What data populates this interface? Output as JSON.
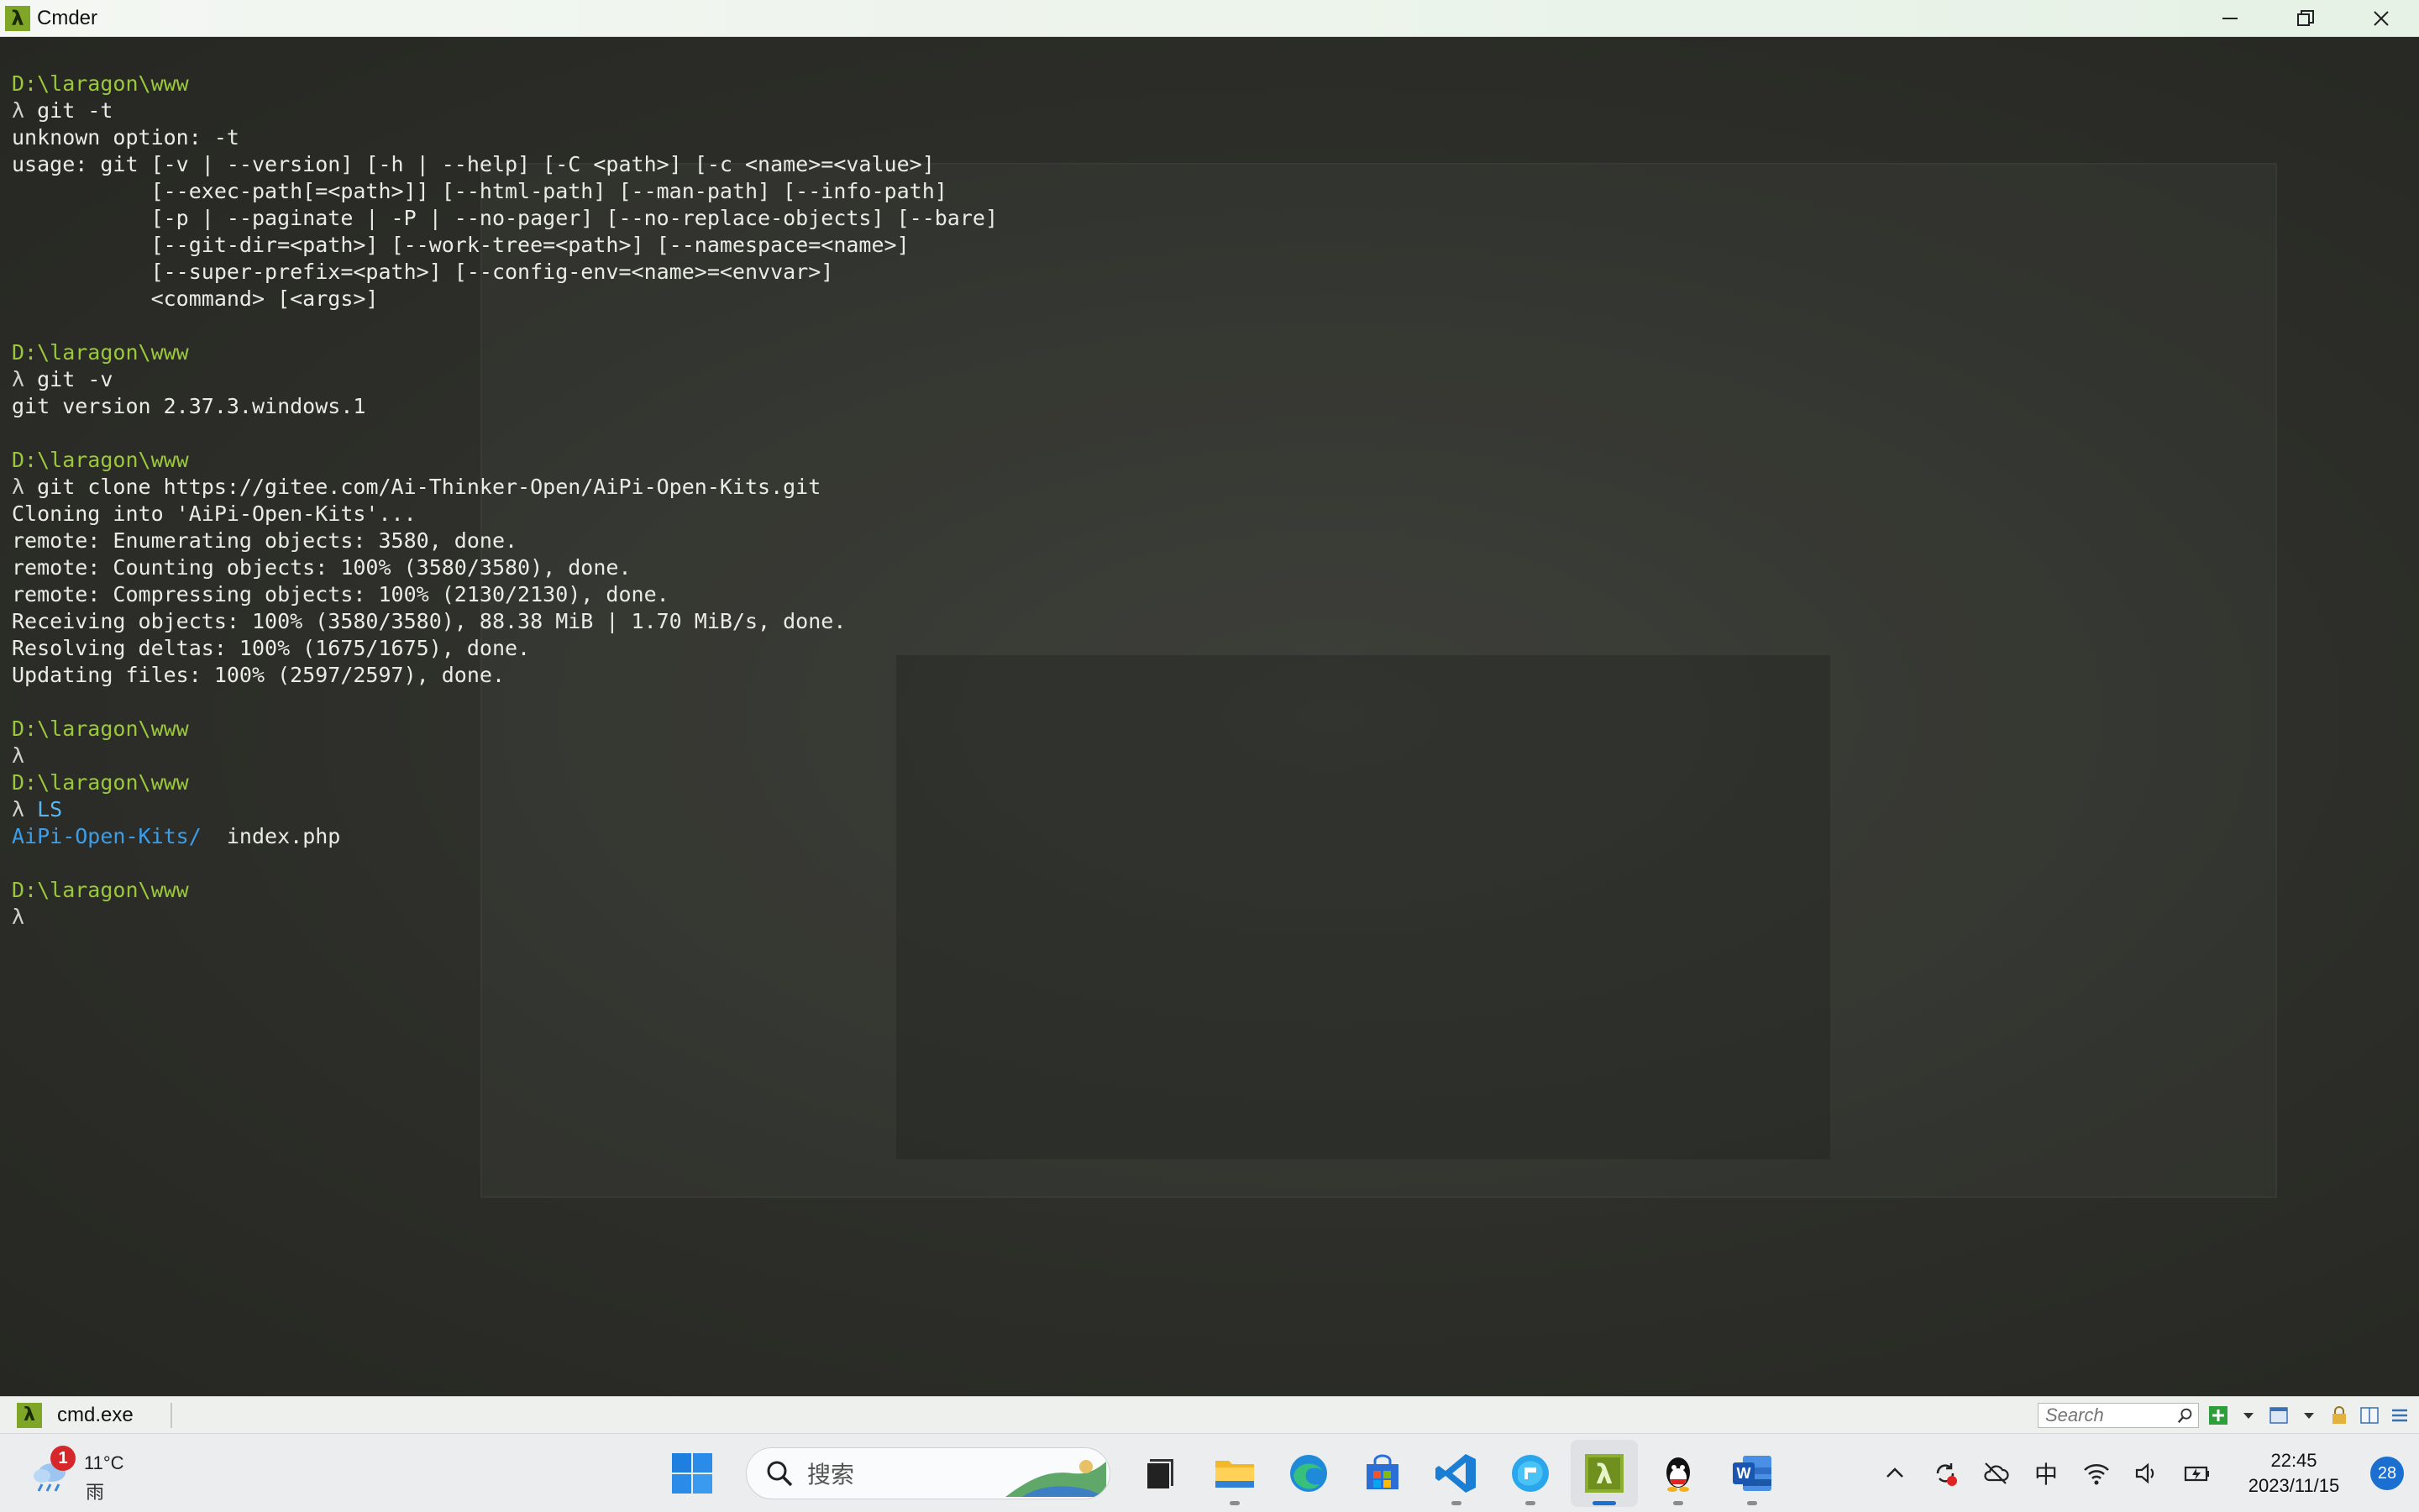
{
  "window": {
    "title": "Cmder",
    "app_icon": "λ",
    "controls": [
      "minimize-icon",
      "restore-icon",
      "close-icon"
    ]
  },
  "terminal": {
    "colors": {
      "path": "#9bc83a",
      "text": "#ebebe6",
      "command_blue": "#59b7f0",
      "dir_blue": "#3d9ee8"
    },
    "lines": [
      {
        "segments": [
          {
            "t": "D:\\laragon\\www",
            "c": "path"
          }
        ]
      },
      {
        "segments": [
          {
            "t": "λ ",
            "c": "lambda"
          },
          {
            "t": "git -t",
            "c": ""
          }
        ]
      },
      {
        "segments": [
          {
            "t": "unknown option: -t",
            "c": ""
          }
        ]
      },
      {
        "segments": [
          {
            "t": "usage: git [-v | --version] [-h | --help] [-C <path>] [-c <name>=<value>]",
            "c": ""
          }
        ]
      },
      {
        "segments": [
          {
            "t": "           [--exec-path[=<path>]] [--html-path] [--man-path] [--info-path]",
            "c": ""
          }
        ]
      },
      {
        "segments": [
          {
            "t": "           [-p | --paginate | -P | --no-pager] [--no-replace-objects] [--bare]",
            "c": ""
          }
        ]
      },
      {
        "segments": [
          {
            "t": "           [--git-dir=<path>] [--work-tree=<path>] [--namespace=<name>]",
            "c": ""
          }
        ]
      },
      {
        "segments": [
          {
            "t": "           [--super-prefix=<path>] [--config-env=<name>=<envvar>]",
            "c": ""
          }
        ]
      },
      {
        "segments": [
          {
            "t": "           <command> [<args>]",
            "c": ""
          }
        ]
      },
      {
        "segments": []
      },
      {
        "segments": [
          {
            "t": "D:\\laragon\\www",
            "c": "path"
          }
        ]
      },
      {
        "segments": [
          {
            "t": "λ ",
            "c": "lambda"
          },
          {
            "t": "git -v",
            "c": ""
          }
        ]
      },
      {
        "segments": [
          {
            "t": "git version 2.37.3.windows.1",
            "c": ""
          }
        ]
      },
      {
        "segments": []
      },
      {
        "segments": [
          {
            "t": "D:\\laragon\\www",
            "c": "path"
          }
        ]
      },
      {
        "segments": [
          {
            "t": "λ ",
            "c": "lambda"
          },
          {
            "t": "git clone https://gitee.com/Ai-Thinker-Open/AiPi-Open-Kits.git",
            "c": ""
          }
        ]
      },
      {
        "segments": [
          {
            "t": "Cloning into 'AiPi-Open-Kits'...",
            "c": ""
          }
        ]
      },
      {
        "segments": [
          {
            "t": "remote: Enumerating objects: 3580, done.",
            "c": ""
          }
        ]
      },
      {
        "segments": [
          {
            "t": "remote: Counting objects: 100% (3580/3580), done.",
            "c": ""
          }
        ]
      },
      {
        "segments": [
          {
            "t": "remote: Compressing objects: 100% (2130/2130), done.",
            "c": ""
          }
        ]
      },
      {
        "segments": [
          {
            "t": "Receiving objects: 100% (3580/3580), 88.38 MiB | 1.70 MiB/s, done.",
            "c": ""
          }
        ]
      },
      {
        "segments": [
          {
            "t": "Resolving deltas: 100% (1675/1675), done.",
            "c": ""
          }
        ]
      },
      {
        "segments": [
          {
            "t": "Updating files: 100% (2597/2597), done.",
            "c": ""
          }
        ]
      },
      {
        "segments": []
      },
      {
        "segments": [
          {
            "t": "D:\\laragon\\www",
            "c": "path"
          }
        ]
      },
      {
        "segments": [
          {
            "t": "λ",
            "c": "lambda"
          }
        ]
      },
      {
        "segments": [
          {
            "t": "D:\\laragon\\www",
            "c": "path"
          }
        ]
      },
      {
        "segments": [
          {
            "t": "λ ",
            "c": "lambda"
          },
          {
            "t": "LS",
            "c": "cmd-blue"
          }
        ]
      },
      {
        "segments": [
          {
            "t": "AiPi-Open-Kits/",
            "c": "dir-blue"
          },
          {
            "t": "  index.php",
            "c": ""
          }
        ]
      },
      {
        "segments": []
      },
      {
        "segments": [
          {
            "t": "D:\\laragon\\www",
            "c": "path"
          }
        ]
      },
      {
        "segments": [
          {
            "t": "λ",
            "c": "lambda"
          }
        ]
      }
    ]
  },
  "statusbar": {
    "tab_icon": "λ",
    "tab_label": "cmd.exe",
    "search_placeholder": "Search"
  },
  "taskbar": {
    "weather": {
      "badge": "1",
      "temp": "11°C",
      "condition": "雨"
    },
    "search_placeholder": "搜索",
    "apps": [
      "windows-start-icon",
      "task-view-icon",
      "file-explorer-icon",
      "edge-icon",
      "store-icon",
      "vscode-icon",
      "browser-icon",
      "cmder-icon",
      "qq-icon",
      "word-icon"
    ],
    "ime": "中",
    "time": "22:45",
    "date": "2023/11/15",
    "notifications": "28"
  }
}
